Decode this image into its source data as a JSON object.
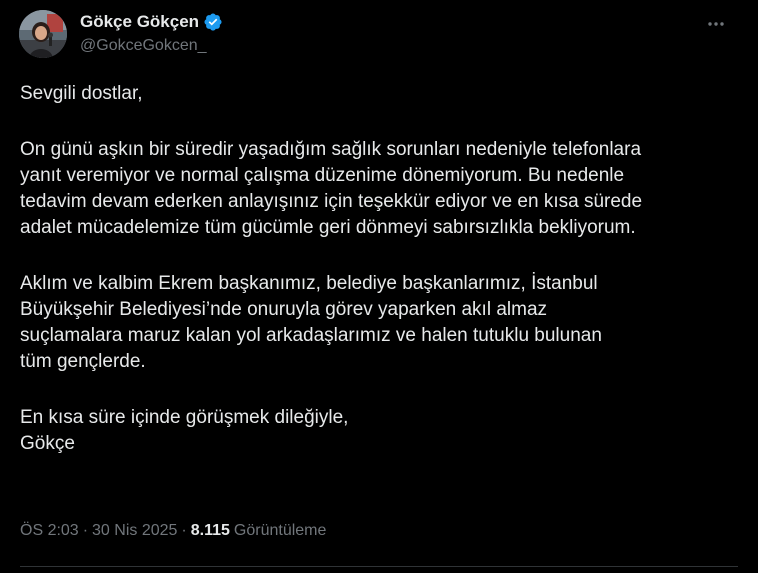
{
  "author": {
    "display_name": "Gökçe Gökçen",
    "handle": "@GokceGokcen_",
    "verified": true,
    "avatar_icon": "avatar-photo"
  },
  "menu": {
    "icon": "more-horizontal-icon"
  },
  "tweet": {
    "paragraphs": [
      "Sevgili dostlar,",
      "On günü aşkın bir süredir yaşadığım sağlık sorunları nedeniyle telefonlara\nyanıt veremiyor ve normal çalışma düzenime dönemiyorum. Bu nedenle\ntedavim devam ederken anlayışınız için teşekkür ediyor ve en kısa sürede\nadalet mücadelemize tüm gücümle geri dönmeyi sabırsızlıkla bekliyorum.",
      "Aklım ve kalbim Ekrem başkanımız, belediye başkanlarımız, İstanbul\nBüyükşehir Belediyesi’nde onuruyla görev yaparken akıl almaz\nsuçlamalara maruz kalan yol arkadaşlarımız ve halen tutuklu bulunan\ntüm gençlerde.",
      "En kısa süre içinde görüşmek dileğiyle,\nGökçe"
    ]
  },
  "meta": {
    "time": "ÖS 2:03",
    "date": "30 Nis 2025",
    "views_count": "8.115",
    "views_label": "Görüntüleme",
    "separator": "·"
  },
  "colors": {
    "background": "#000000",
    "text": "#e7e9ea",
    "secondary": "#71767b",
    "verified": "#1d9bf0"
  }
}
